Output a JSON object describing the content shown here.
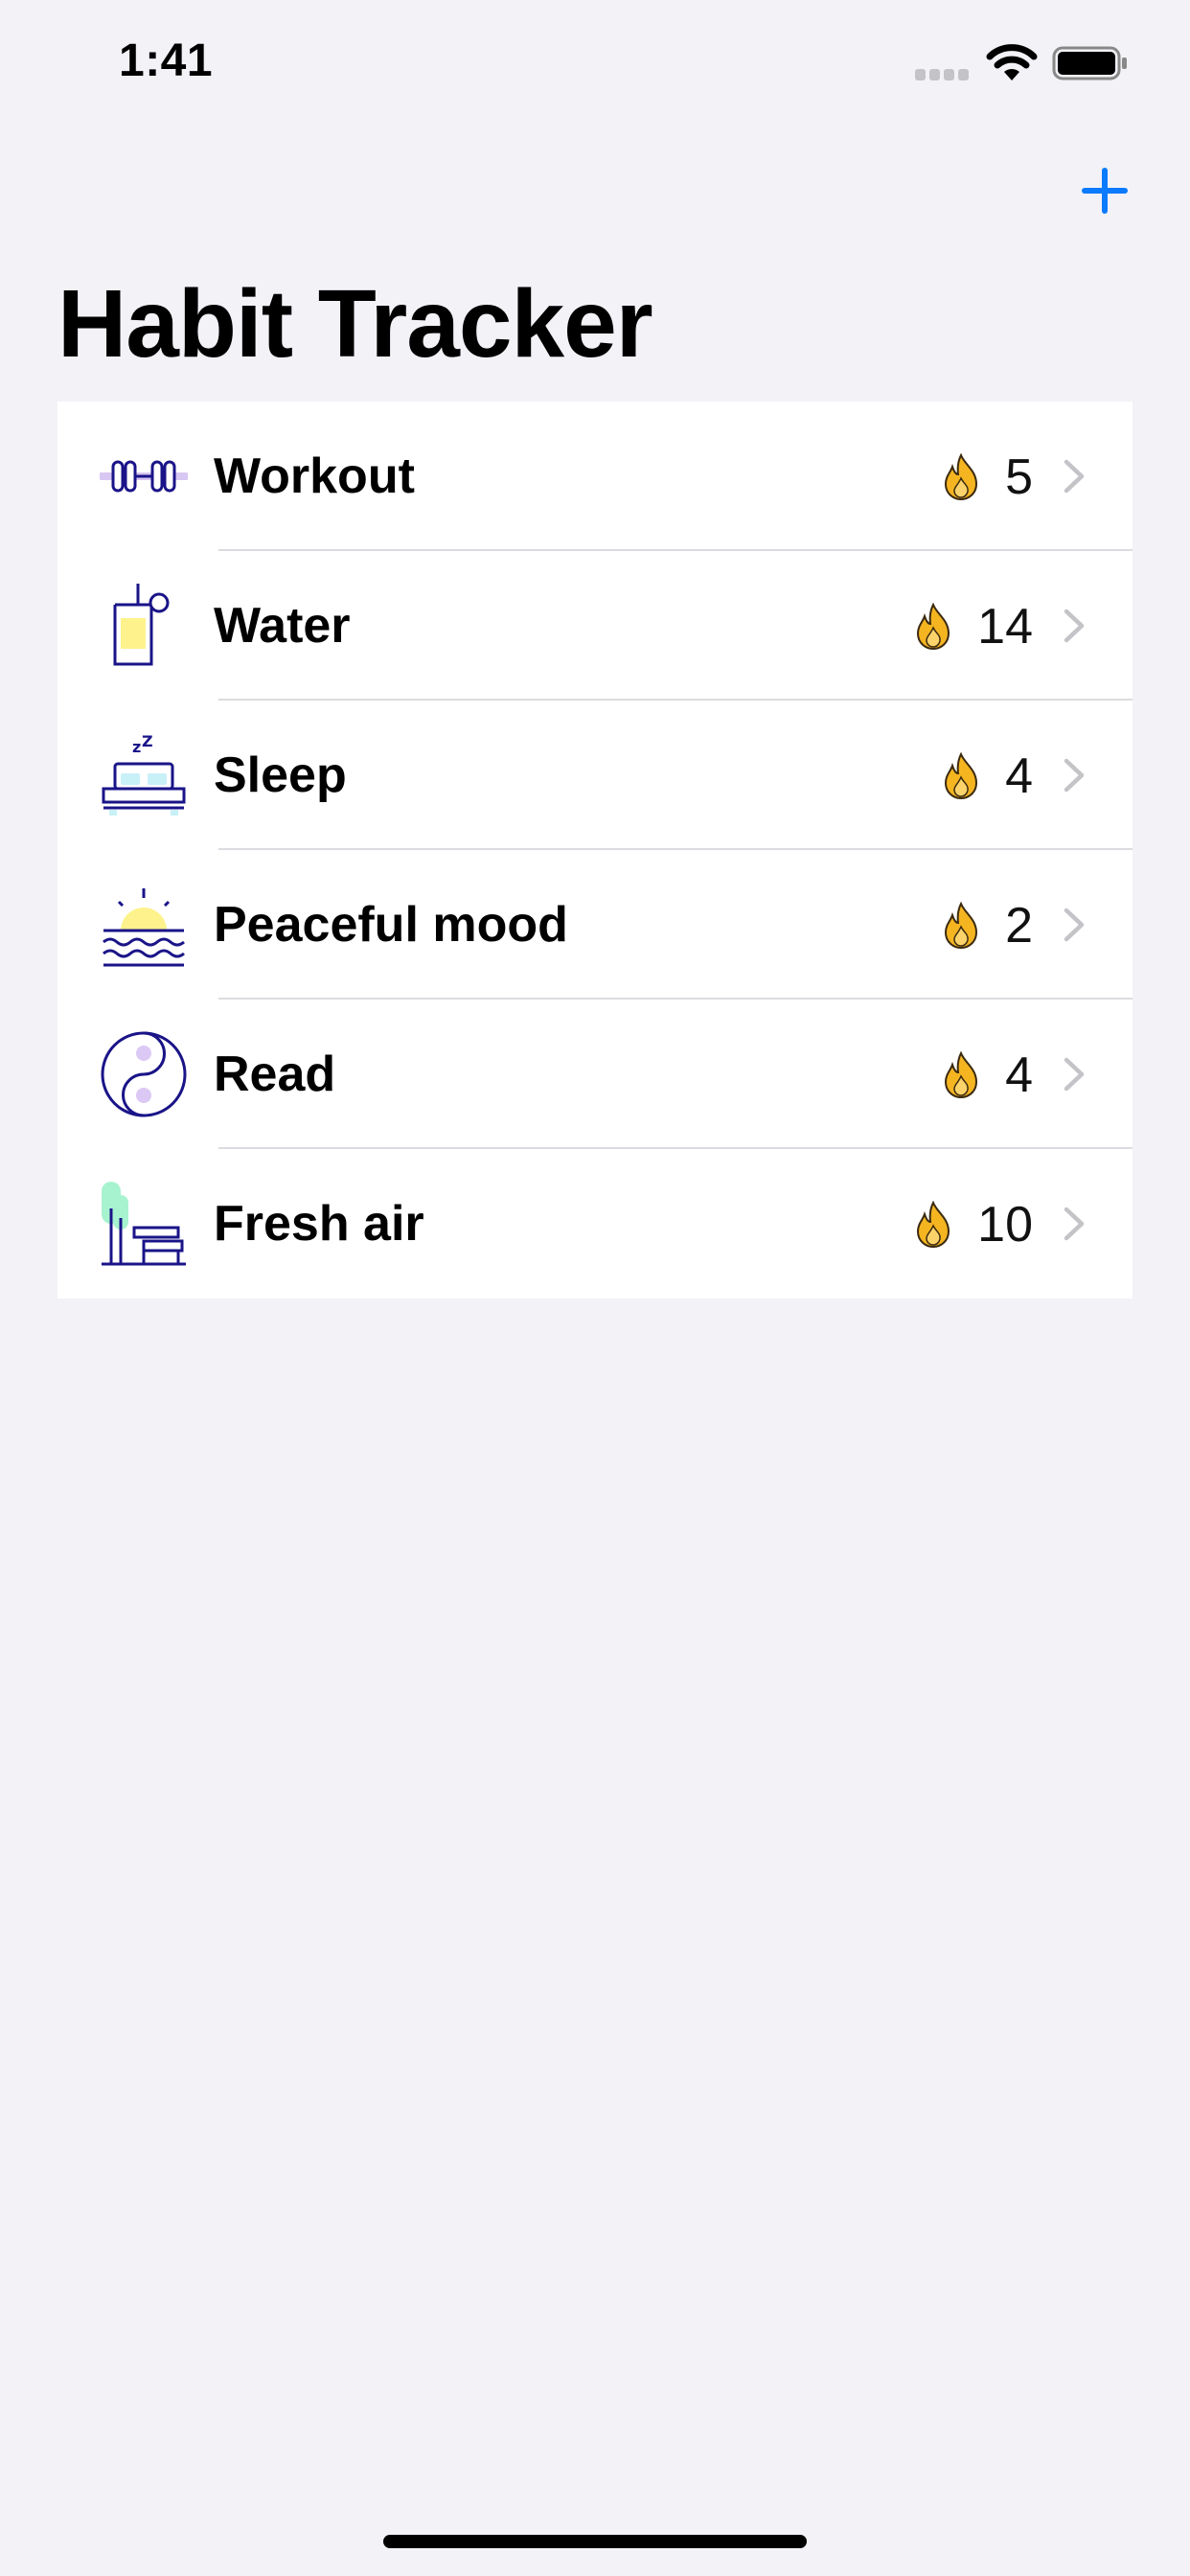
{
  "status_bar": {
    "time": "1:41"
  },
  "nav": {
    "title": "Habit Tracker",
    "add_icon": "plus-icon",
    "accent_color": "#0a7aff"
  },
  "habits": [
    {
      "name": "Workout",
      "icon": "dumbbell-icon",
      "streak": "5"
    },
    {
      "name": "Water",
      "icon": "glass-of-water-icon",
      "streak": "14"
    },
    {
      "name": "Sleep",
      "icon": "bed-icon",
      "streak": "4"
    },
    {
      "name": "Peaceful mood",
      "icon": "sunset-over-sea-icon",
      "streak": "2"
    },
    {
      "name": "Read",
      "icon": "yin-yang-icon",
      "streak": "4"
    },
    {
      "name": "Fresh air",
      "icon": "tree-and-bench-icon",
      "streak": "10"
    }
  ],
  "colors": {
    "background": "#f2f2f7",
    "icon_stroke": "#1a1488",
    "flame": "#f5b521",
    "chevron": "#c4c4c8"
  }
}
